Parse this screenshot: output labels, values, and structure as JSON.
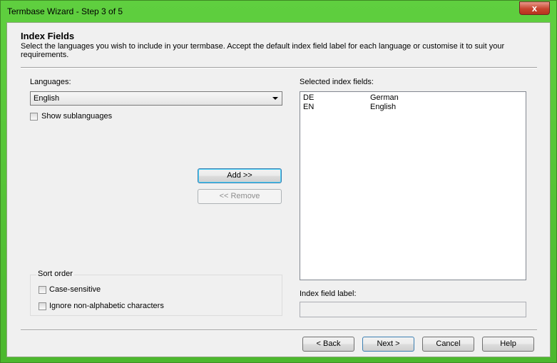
{
  "window": {
    "title": "Termbase Wizard - Step 3 of 5",
    "close_glyph": "x",
    "accent_color": "#4cb82e"
  },
  "header": {
    "title": "Index Fields",
    "subtitle": "Select the languages you wish to include in your termbase. Accept the default index field label for each language or customise it to suit your requirements."
  },
  "languages": {
    "label": "Languages:",
    "selected": "English",
    "show_sublanguages_label": "Show sublanguages",
    "show_sublanguages_checked": false
  },
  "actions": {
    "add_label": "Add >>",
    "remove_label": "<< Remove"
  },
  "sort_order": {
    "group_label": "Sort order",
    "case_sensitive_label": "Case-sensitive",
    "case_sensitive_checked": false,
    "ignore_nonalpha_label": "Ignore non-alphabetic characters",
    "ignore_nonalpha_checked": false
  },
  "selected_fields": {
    "label": "Selected index fields:",
    "rows": [
      {
        "code": "DE",
        "name": "German"
      },
      {
        "code": "EN",
        "name": "English"
      }
    ]
  },
  "index_field_label": {
    "label": "Index field label:",
    "value": ""
  },
  "footer": {
    "back_label": "< Back",
    "next_label": "Next >",
    "cancel_label": "Cancel",
    "help_label": "Help"
  }
}
